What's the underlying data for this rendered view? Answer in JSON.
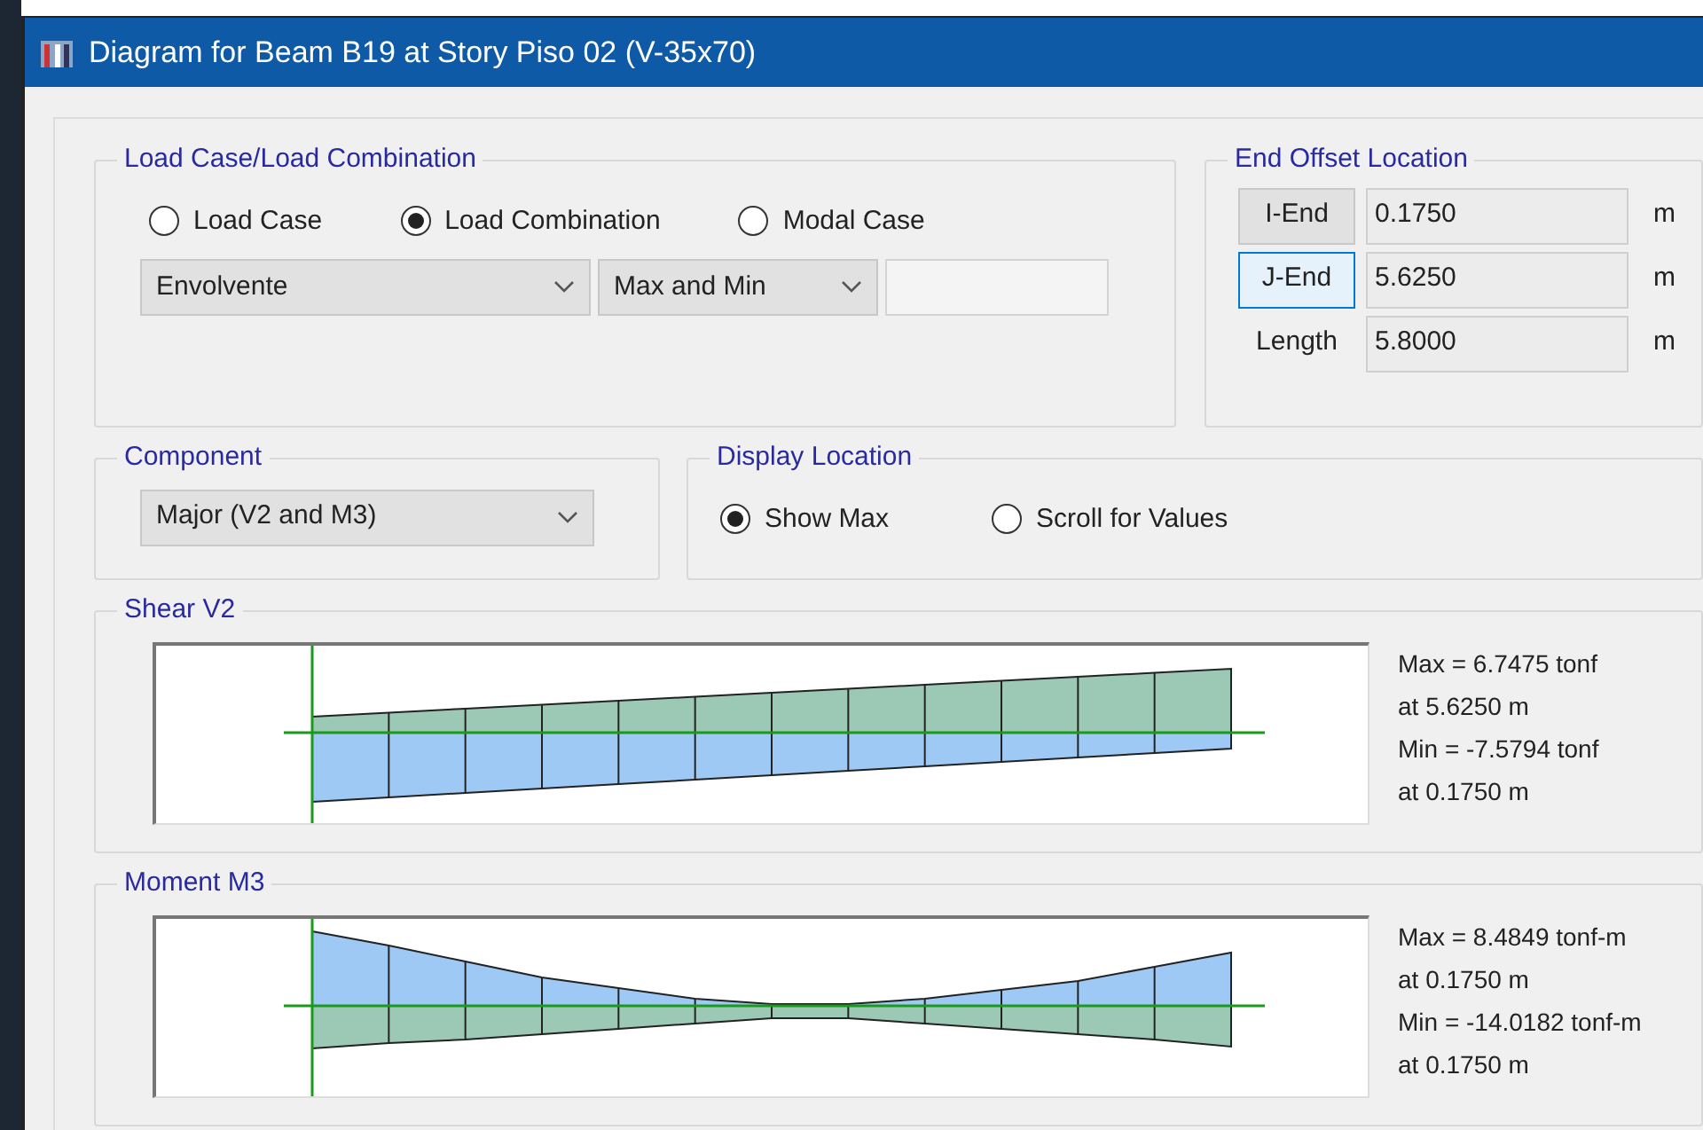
{
  "window": {
    "title": "Diagram for Beam B19 at Story Piso 02 (V-35x70)"
  },
  "load_case": {
    "title": "Load Case/Load Combination",
    "options": [
      {
        "label": "Load Case",
        "selected": false
      },
      {
        "label": "Load Combination",
        "selected": true
      },
      {
        "label": "Modal Case",
        "selected": false
      }
    ],
    "combo": {
      "value": "Envolvente"
    },
    "mode": {
      "value": "Max and Min"
    }
  },
  "end_offset": {
    "title": "End Offset Location",
    "rows": [
      {
        "kind": "button",
        "label": "I-End",
        "focused": false,
        "value": "0.1750",
        "unit": "m"
      },
      {
        "kind": "button",
        "label": "J-End",
        "focused": true,
        "value": "5.6250",
        "unit": "m"
      },
      {
        "kind": "label",
        "label": "Length",
        "value": "5.8000",
        "unit": "m"
      }
    ]
  },
  "component": {
    "title": "Component",
    "value": "Major (V2 and M3)"
  },
  "display_location": {
    "title": "Display Location",
    "options": [
      {
        "label": "Show Max",
        "selected": true
      },
      {
        "label": "Scroll for Values",
        "selected": false
      }
    ]
  },
  "diagrams": [
    {
      "kind": "shear",
      "title": "Shear V2",
      "results": [
        "Max = 6.7475 tonf",
        "at 5.6250 m",
        "Min = -7.5794 tonf",
        "at 0.1750 m"
      ]
    },
    {
      "kind": "moment",
      "title": "Moment M3",
      "results": [
        "Max = 8.4849 tonf-m",
        "at 0.1750 m",
        "Min = -14.0182 tonf-m",
        "at 0.1750 m"
      ]
    }
  ]
}
